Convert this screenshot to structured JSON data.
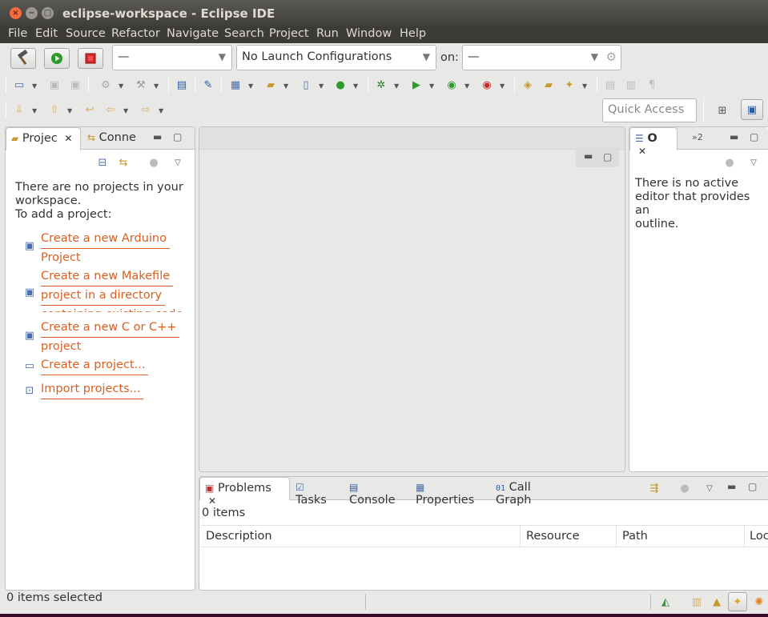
{
  "window": {
    "title": "eclipse-workspace - Eclipse IDE",
    "close_glyph": "×",
    "minimize_glyph": "−",
    "maximize_glyph": "□"
  },
  "menu": [
    "File",
    "Edit",
    "Source",
    "Refactor",
    "Navigate",
    "Search",
    "Project",
    "Run",
    "Window",
    "Help"
  ],
  "toolbar": {
    "mode_combo": "—",
    "launch_config_combo": "No Launch Configurations",
    "on_label": "on:",
    "target_combo": "—",
    "quick_access_placeholder": "Quick Access"
  },
  "project_explorer": {
    "tab_label": "Projec",
    "second_tab_label": "Conne",
    "message_line1": "There are no projects in your",
    "message_line2": "workspace.",
    "message_line3": "To add a project:",
    "links": [
      {
        "line1": "Create a new Arduino",
        "line2": "Project",
        "line3": ""
      },
      {
        "line1": "Create a new Makefile",
        "line2": "project in a directory",
        "line3": "containing existing code"
      },
      {
        "line1": "Create a new C or C++",
        "line2": "project",
        "line3": ""
      },
      {
        "line1": "Create a project...",
        "line2": "",
        "line3": ""
      },
      {
        "line1": "Import projects...",
        "line2": "",
        "line3": ""
      }
    ]
  },
  "outline": {
    "tab_label": "O",
    "overflow_label": "»2",
    "message_line1": "There is no active",
    "message_line2": "editor that provides an",
    "message_line3": "outline."
  },
  "bottom_panel": {
    "tabs": [
      "Problems",
      "Tasks",
      "Console",
      "Properties",
      "Call Graph"
    ],
    "count": "0 items",
    "columns": [
      "Description",
      "Resource",
      "Path",
      "Loc"
    ]
  },
  "status": {
    "text": "0 items selected"
  },
  "colors": {
    "link": "#d95f22",
    "chrome": "#3c3b37",
    "background": "#e8e8e7"
  }
}
